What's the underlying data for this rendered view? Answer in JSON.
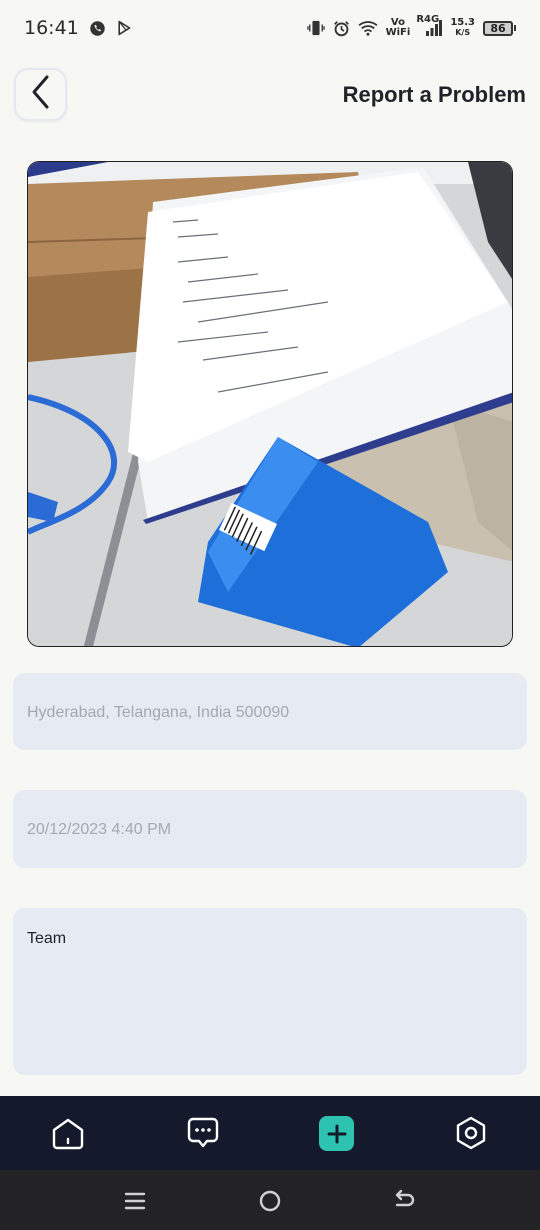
{
  "status_bar": {
    "time": "16:41",
    "network_vo": "Vo",
    "network_wifi": "WiFi",
    "network_type": "R4G",
    "speed_value": "15.3",
    "speed_unit": "K/S",
    "battery": "86",
    "icons": [
      "whatsapp-icon",
      "play-store-icon",
      "vibrate-icon",
      "alarm-icon",
      "wifi-icon",
      "signal-icon",
      "battery-icon"
    ]
  },
  "header": {
    "title": "Report a Problem",
    "back_icon": "chevron-left-icon"
  },
  "form": {
    "location": "Hyderabad, Telangana, India 500090",
    "datetime": "20/12/2023 4:40 PM",
    "description": "Team"
  },
  "bottom_nav": {
    "items": [
      "home-icon",
      "chat-icon",
      "add-icon",
      "settings-icon"
    ],
    "accent_color": "#2ec3b1",
    "background_color": "#141a2b"
  },
  "system_nav": {
    "items": [
      "recent-apps-icon",
      "home-circle-icon",
      "back-arrow-icon"
    ]
  }
}
